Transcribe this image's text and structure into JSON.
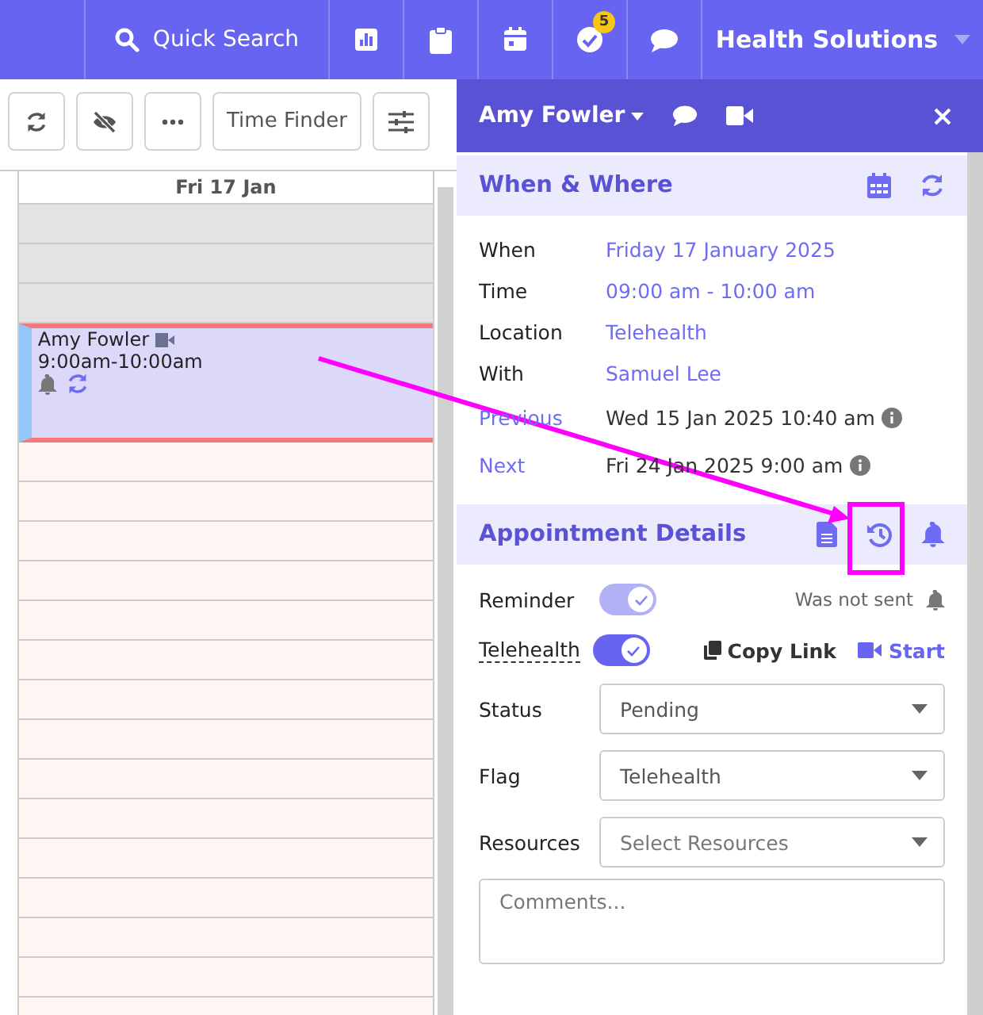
{
  "top_bar": {
    "search_label": "Quick Search",
    "notification_count": "5",
    "organization": "Health Solutions"
  },
  "toolbar": {
    "time_finder": "Time Finder"
  },
  "calendar": {
    "day_header": "Fri 17 Jan",
    "event": {
      "name": "Amy Fowler",
      "time": "9:00am-10:00am",
      "telehealth": true,
      "reminder": true,
      "recurring": true
    }
  },
  "panel": {
    "patient_name": "Amy Fowler",
    "when_where": {
      "title": "When & Where",
      "rows": [
        {
          "label": "When",
          "value": "Friday 17 January 2025"
        },
        {
          "label": "Time",
          "value": "09:00 am - 10:00 am"
        },
        {
          "label": "Location",
          "value": "Telehealth"
        },
        {
          "label": "With",
          "value": "Samuel Lee"
        }
      ],
      "links": [
        {
          "label": "Previous",
          "value": "Wed 15 Jan 2025 10:40 am"
        },
        {
          "label": "Next",
          "value": "Fri 24 Jan 2025 9:00 am"
        }
      ]
    },
    "details": {
      "title": "Appointment Details",
      "reminder": {
        "label": "Reminder",
        "on": true,
        "disabled": true,
        "note": "Was not sent"
      },
      "telehealth": {
        "label": "Telehealth",
        "on": true,
        "disabled": false,
        "copy_link": "Copy Link",
        "start": "Start"
      },
      "selects": [
        {
          "label": "Status",
          "value": "Pending"
        },
        {
          "label": "Flag",
          "value": "Telehealth"
        },
        {
          "label": "Resources",
          "placeholder": "Select Resources"
        }
      ],
      "comments": {
        "placeholder": "Comments..."
      }
    }
  },
  "annotation": {
    "kind": "arrow-to-box"
  }
}
